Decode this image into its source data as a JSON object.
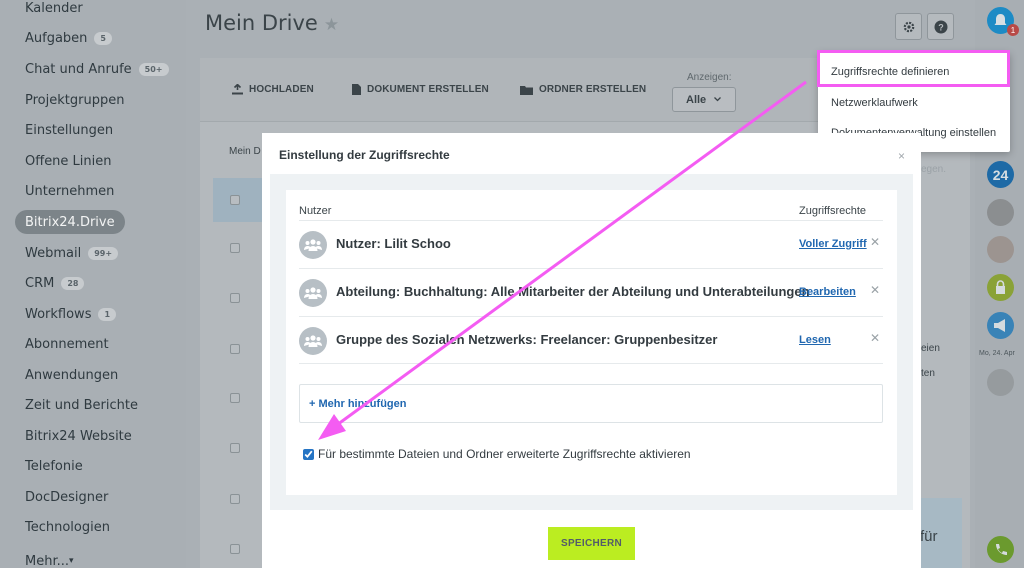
{
  "sidebar": {
    "items": [
      {
        "label": "Kalender",
        "counter": ""
      },
      {
        "label": "Aufgaben",
        "counter": "5"
      },
      {
        "label": "Chat und Anrufe",
        "counter": "50+"
      },
      {
        "label": "Projektgruppen",
        "counter": ""
      },
      {
        "label": "Einstellungen",
        "counter": ""
      },
      {
        "label": "Offene Linien",
        "counter": ""
      },
      {
        "label": "Unternehmen",
        "counter": ""
      },
      {
        "label": "Bitrix24.Drive",
        "counter": ""
      },
      {
        "label": "Webmail",
        "counter": "99+"
      },
      {
        "label": "CRM",
        "counter": "28"
      },
      {
        "label": "Workflows",
        "counter": "1"
      },
      {
        "label": "Abonnement",
        "counter": ""
      },
      {
        "label": "Anwendungen",
        "counter": ""
      },
      {
        "label": "Zeit und Berichte",
        "counter": ""
      },
      {
        "label": "Bitrix24 Website",
        "counter": ""
      },
      {
        "label": "Telefonie",
        "counter": ""
      },
      {
        "label": "DocDesigner",
        "counter": ""
      },
      {
        "label": "Technologien",
        "counter": ""
      },
      {
        "label": "Mehr...",
        "counter": ""
      }
    ]
  },
  "header": {
    "title": "Mein Drive",
    "star": "★"
  },
  "toolbar": {
    "upload": "HOCHLADEN",
    "create_doc": "DOKUMENT ERSTELLEN",
    "create_folder": "ORDNER ERSTELLEN",
    "show_label": "Anzeigen:",
    "show_value": "Alle"
  },
  "background": {
    "breadcrumb_fragment": "Mein D",
    "right_fragments": [
      "eien",
      "ten",
      "egen.",
      "für"
    ],
    "date_fragment": "Mo, 24. Apr"
  },
  "popup": {
    "items": [
      "Zugriffsrechte definieren",
      "Netzwerklaufwerk",
      "Dokumentenverwaltung einstellen"
    ]
  },
  "modal": {
    "title": "Einstellung der Zugriffsrechte",
    "close": "×",
    "columns": {
      "user": "Nutzer",
      "rights": "Zugriffsrechte"
    },
    "rows": [
      {
        "name": "Nutzer: Lilit Schoo",
        "right": "Voller Zugriff"
      },
      {
        "name": "Abteilung: Buchhaltung: Alle Mitarbeiter der Abteilung und Unterabteilungen",
        "right": "Bearbeiten"
      },
      {
        "name": "Gruppe des Sozialen Netzwerks: Freelancer: Gruppenbesitzer",
        "right": "Lesen"
      }
    ],
    "add_more": "+ Mehr hinzufügen",
    "extended_label": "Für bestimmte Dateien und Ordner erweiterte Zugriffsrechte aktivieren",
    "extended_checked": true,
    "save": "SPEICHERN"
  },
  "right_bar": {
    "notification_count": "1",
    "badge_24": "24"
  },
  "colors": {
    "accent_link": "#2067b0",
    "save_button": "#bbed21",
    "annotation": "#f45cf2"
  }
}
